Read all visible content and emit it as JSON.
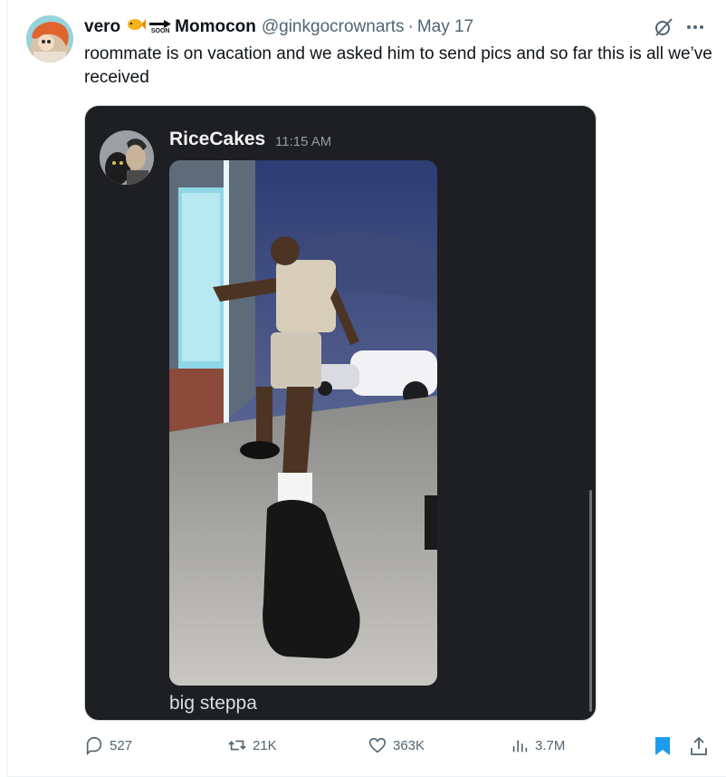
{
  "tweet": {
    "display_name": "vero",
    "emoji_soon_text": "SOON",
    "display_name_2": "Momocon",
    "handle": "@ginkgocrownarts",
    "separator": "·",
    "date": "May 17",
    "text": "roommate is on vacation and we asked him to send pics and so far this is all we’ve received"
  },
  "media": {
    "username": "RiceCakes",
    "time": "11:15 AM",
    "caption": "big steppa"
  },
  "actions": {
    "replies": "527",
    "retweets": "21K",
    "likes": "363K",
    "views": "3.7M"
  },
  "colors": {
    "accent": "#1d9bf0",
    "muted": "#536471",
    "discord_bg": "#1e1f22"
  },
  "icons": {
    "grok": "grok-icon",
    "more": "more-icon",
    "reply": "reply-icon",
    "retweet": "retweet-icon",
    "like": "heart-icon",
    "views": "views-icon",
    "bookmark": "bookmark-icon",
    "share": "share-icon"
  }
}
